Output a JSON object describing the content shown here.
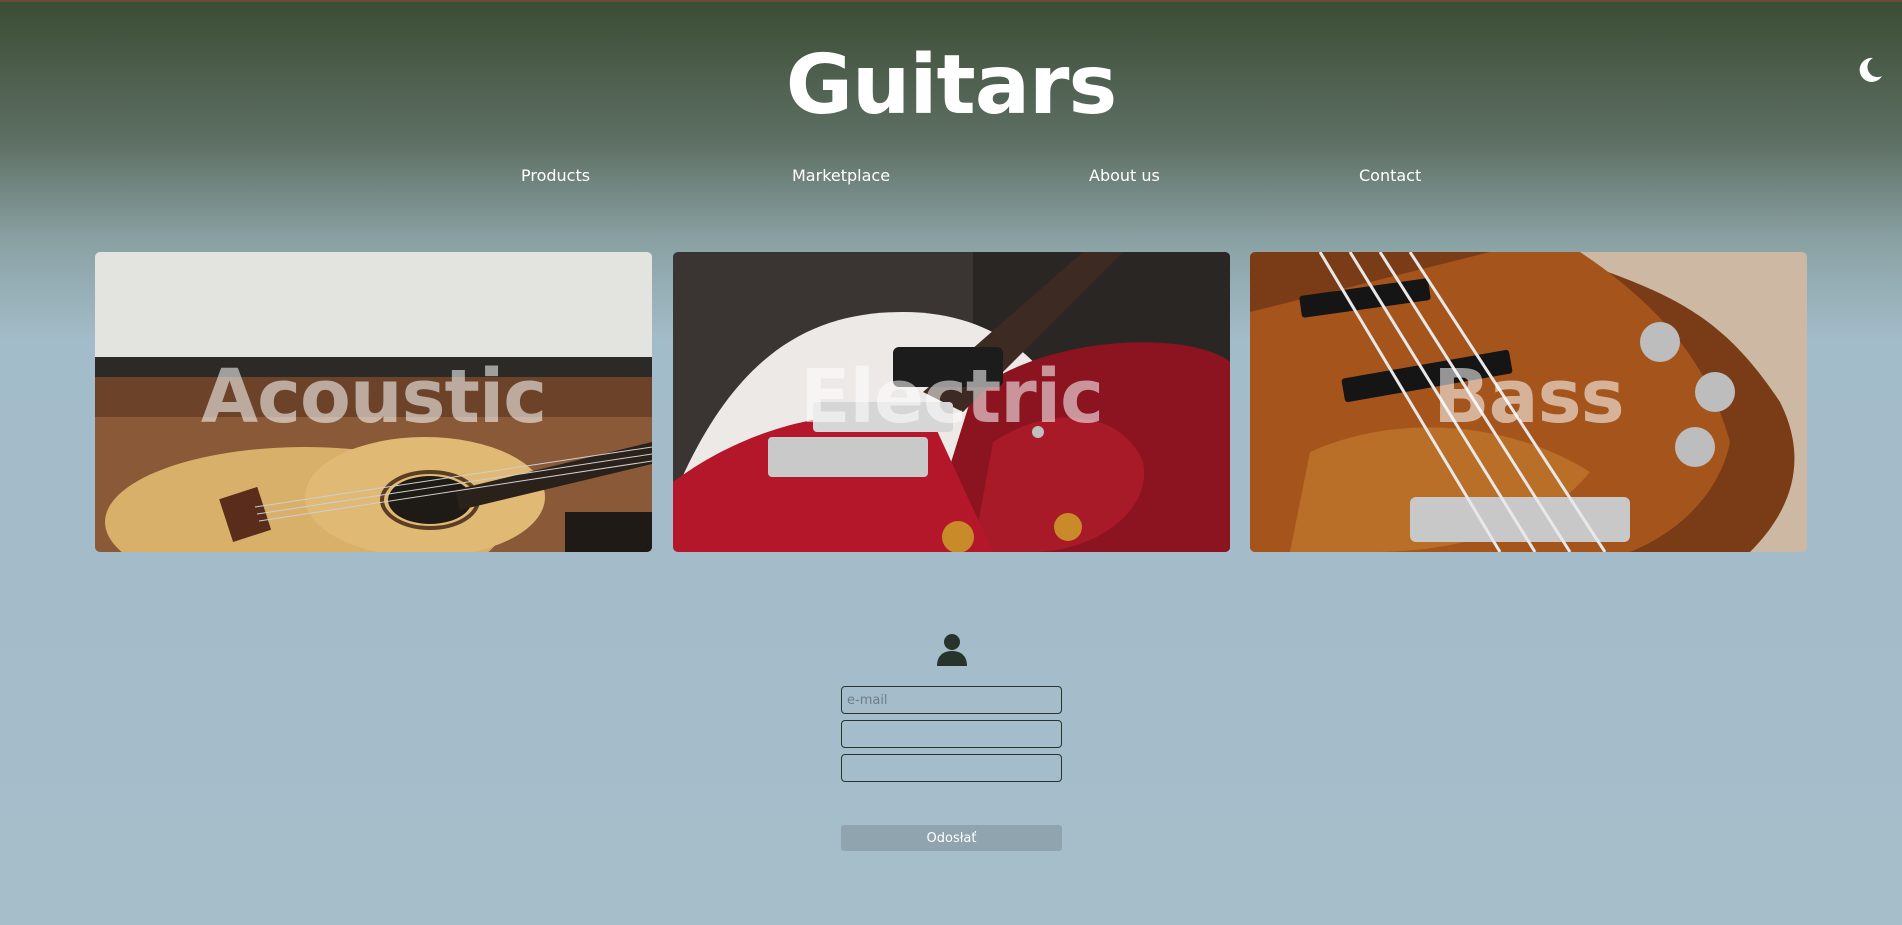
{
  "header": {
    "title": "Guitars",
    "theme_toggle_icon": "moon-icon"
  },
  "nav": {
    "items": [
      {
        "label": "Products"
      },
      {
        "label": "Marketplace"
      },
      {
        "label": "About us"
      },
      {
        "label": "Contact"
      }
    ]
  },
  "categories": [
    {
      "label": "Acoustic",
      "image": "acoustic-guitar-photo"
    },
    {
      "label": "Electric",
      "image": "electric-guitar-photo"
    },
    {
      "label": "Bass",
      "image": "bass-guitar-photo"
    }
  ],
  "login": {
    "icon": "user-icon",
    "email_placeholder": "e-mail",
    "email_value": "",
    "field2_value": "",
    "field3_value": "",
    "submit_label": "Odosłať"
  },
  "colors": {
    "header_dark": "#3b4c34",
    "page_background": "#a6bdca",
    "accent_dark": "#27342b",
    "button": "#8fa4ae"
  }
}
